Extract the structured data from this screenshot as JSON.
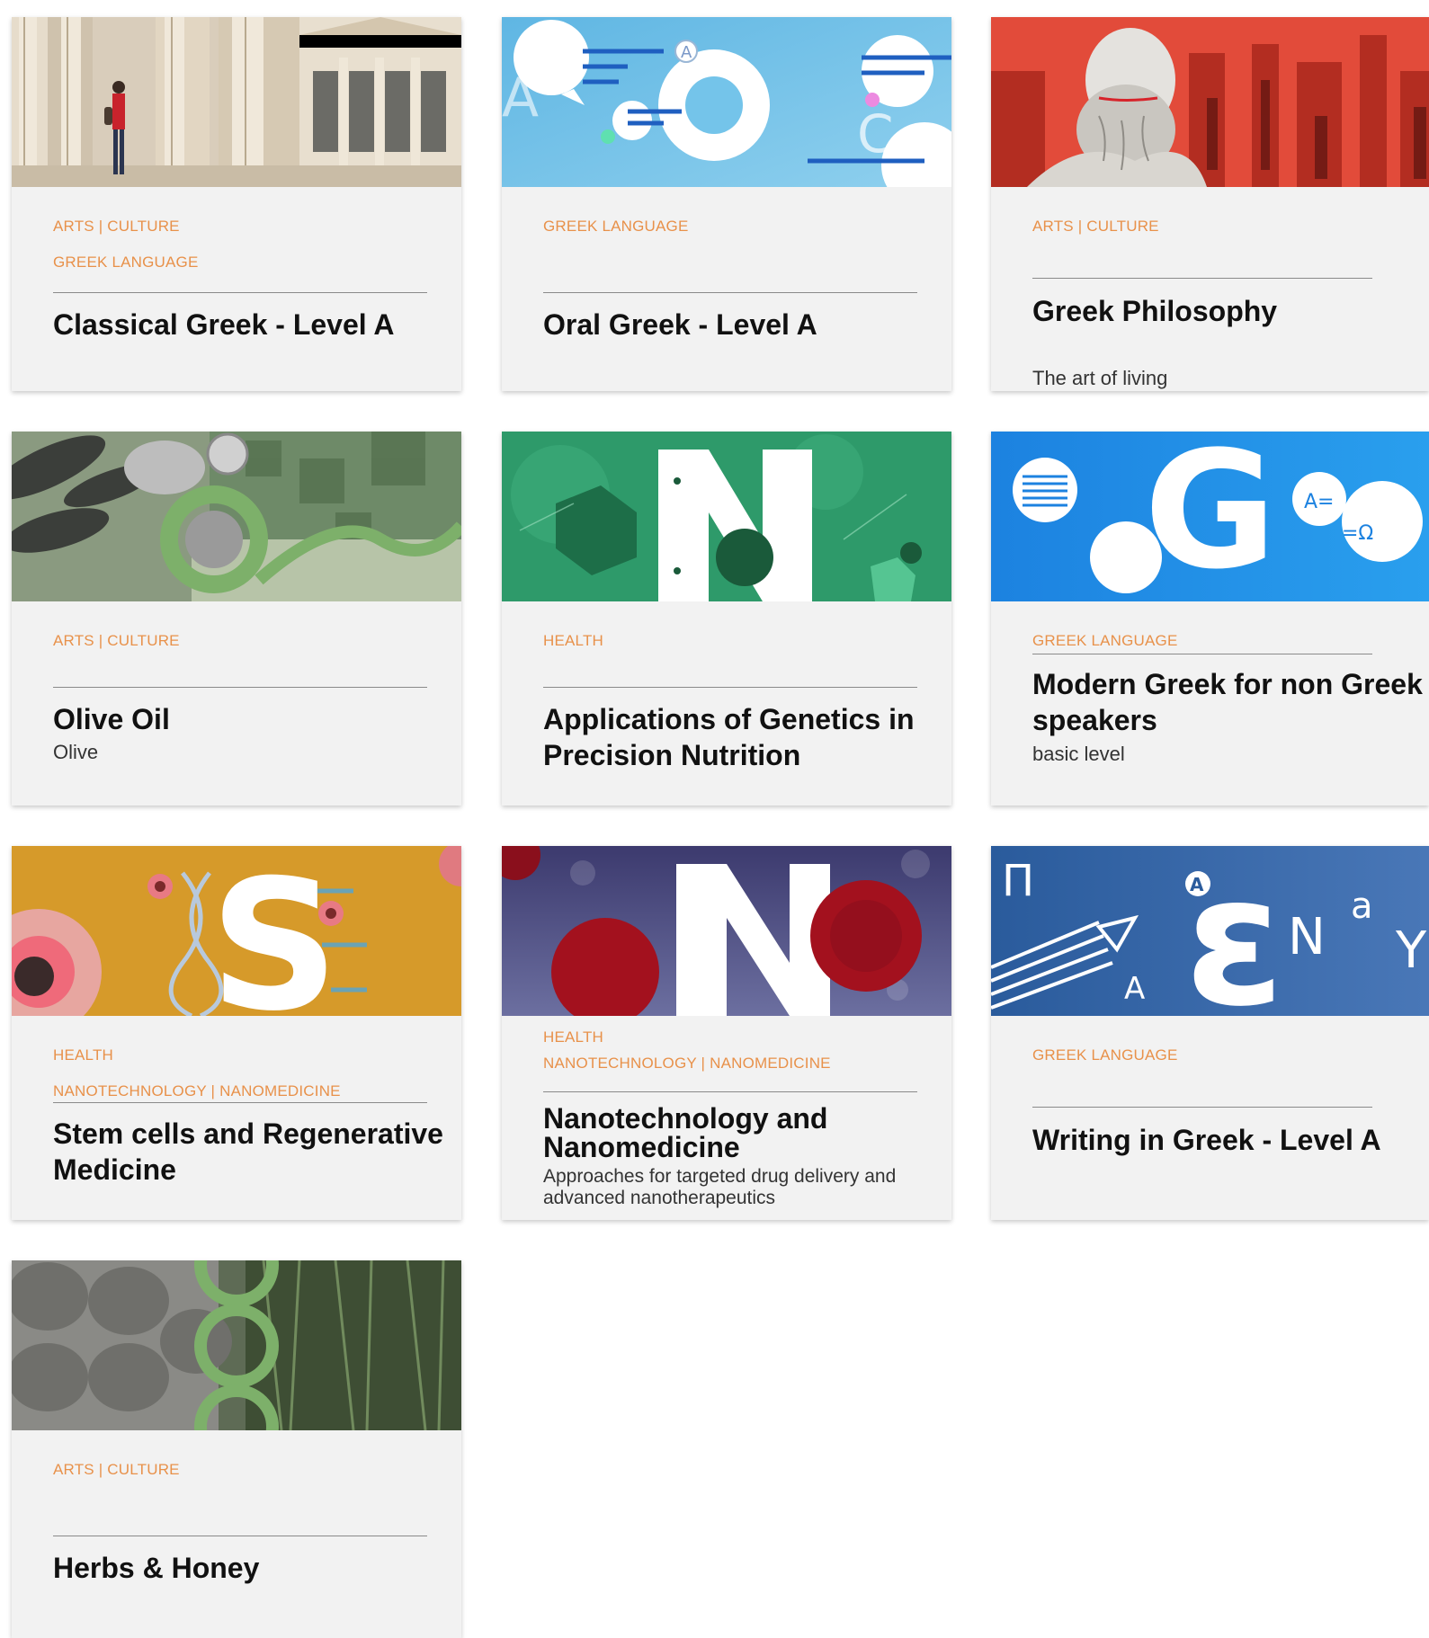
{
  "courses": [
    {
      "categories": [
        "ARTS | CULTURE",
        "GREEK LANGUAGE"
      ],
      "title": "Classical Greek - Level A",
      "subtitle": "",
      "image": "colonnade-photo"
    },
    {
      "categories": [
        "GREEK LANGUAGE"
      ],
      "title": "Oral Greek - Level A",
      "subtitle": "",
      "image": "letter-o-illustration"
    },
    {
      "categories": [
        "ARTS | CULTURE"
      ],
      "title": "Greek Philosophy",
      "subtitle": "The art of living",
      "image": "philosopher-bust-photo"
    },
    {
      "categories": [
        "ARTS | CULTURE"
      ],
      "title": "Olive Oil",
      "subtitle": "Olive",
      "image": "olive-illustration"
    },
    {
      "categories": [
        "HEALTH"
      ],
      "title": "Applications of Genetics in Precision Nutrition",
      "subtitle": "",
      "image": "letter-n-green-illustration"
    },
    {
      "categories": [
        "GREEK LANGUAGE"
      ],
      "title": "Modern Greek for non Greek speakers",
      "subtitle": "basic level",
      "image": "letter-g-illustration"
    },
    {
      "categories": [
        "HEALTH",
        "NANOTECHNOLOGY | NANOMEDICINE"
      ],
      "title": "Stem cells and Regenerative Medicine",
      "subtitle": "",
      "image": "letter-s-dna-illustration"
    },
    {
      "categories": [
        "HEALTH",
        "NANOTECHNOLOGY | NANOMEDICINE"
      ],
      "title": "Nanotechnology and Nanomedicine",
      "subtitle": "Approaches for targeted drug delivery and advanced nanotherapeutics",
      "image": "letter-n-red-cells-illustration"
    },
    {
      "categories": [
        "GREEK LANGUAGE"
      ],
      "title": "Writing in Greek - Level A",
      "subtitle": "",
      "image": "letter-epsilon-illustration"
    },
    {
      "categories": [
        "ARTS | CULTURE"
      ],
      "title": "Herbs & Honey",
      "subtitle": "",
      "image": "herbs-honey-illustration"
    }
  ],
  "colors": {
    "category": "#e8914a",
    "title": "#111111",
    "card_bg": "#f2f2f2"
  }
}
